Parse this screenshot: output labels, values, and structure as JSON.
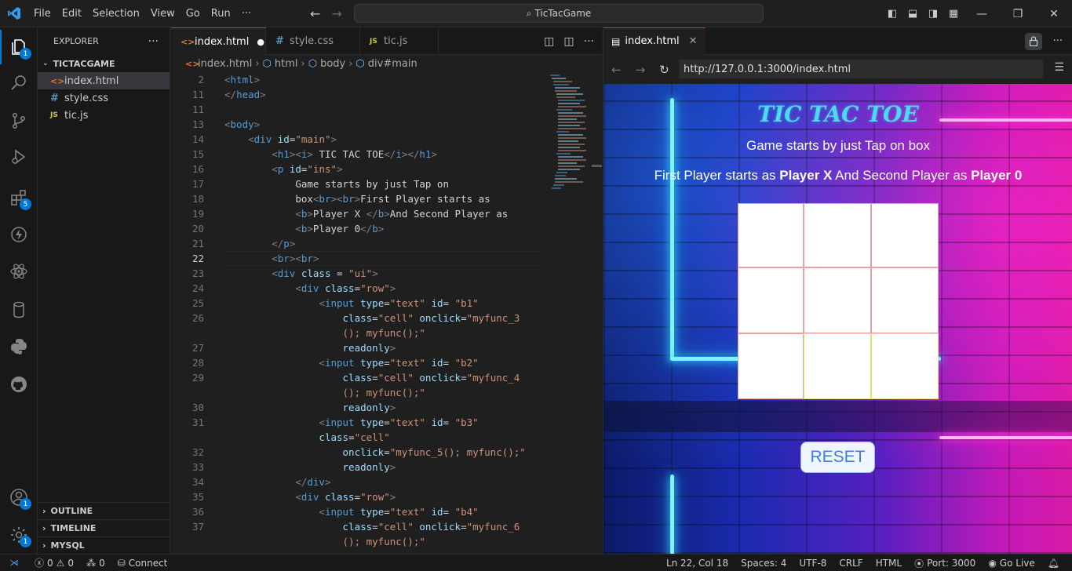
{
  "menu": [
    "File",
    "Edit",
    "Selection",
    "View",
    "Go",
    "Run",
    "···"
  ],
  "search": {
    "text": "TicTacGame"
  },
  "explorer": {
    "title": "EXPLORER",
    "more": "···",
    "folder": "TICTACGAME",
    "files": [
      {
        "icon": "<>",
        "name": "index.html"
      },
      {
        "icon": "#",
        "name": "style.css"
      },
      {
        "icon": "JS",
        "name": "tic.js"
      }
    ],
    "sections": [
      "OUTLINE",
      "TIMELINE",
      "MYSQL"
    ]
  },
  "activity_badges": {
    "explorer": "1",
    "extensions": "5",
    "accounts": "1",
    "manage": "1"
  },
  "editor": {
    "tabs": [
      {
        "icon": "<>",
        "label": "index.html",
        "dirty": "●"
      },
      {
        "icon": "#",
        "label": "style.css"
      },
      {
        "icon": "JS",
        "label": "tic.js"
      }
    ],
    "more": "···",
    "breadcrumb": [
      "index.html",
      "html",
      "body",
      "div#main"
    ],
    "line_numbers": [
      "2",
      "11",
      "11",
      "13",
      "14",
      "15",
      "16",
      "17",
      "18",
      "19",
      "20",
      "21",
      "22",
      "23",
      "24",
      "25",
      "26",
      "",
      "27",
      "28",
      "29",
      "",
      "30",
      "31",
      "",
      "32",
      "33",
      "34",
      "35",
      "36",
      "37",
      ""
    ],
    "current_line": "22"
  },
  "preview": {
    "tab_label": "index.html",
    "url": "http://127.0.0.1:3000/index.html",
    "page": {
      "title": "TIC TAC TOE",
      "instruction": "Game starts by just Tap on box",
      "line2_a": "First Player starts as ",
      "line2_b": "Player X",
      "line2_c": " And Second Player as ",
      "line2_d": "Player 0",
      "reset": "RESET"
    }
  },
  "status": {
    "errors": "0",
    "warnings": "0",
    "ports": "0",
    "connect": "Connect",
    "position": "Ln 22, Col 18",
    "spaces": "Spaces: 4",
    "encoding": "UTF-8",
    "eol": "CRLF",
    "language": "HTML",
    "port": "Port: 3000",
    "golive": "Go Live"
  },
  "colors": {
    "accent": "#0078d4",
    "neon_cyan": "#7ef3ff",
    "neon_pink": "#ff3bd6",
    "title": "#4fd8f0",
    "reset_text": "#3d7fe0"
  }
}
